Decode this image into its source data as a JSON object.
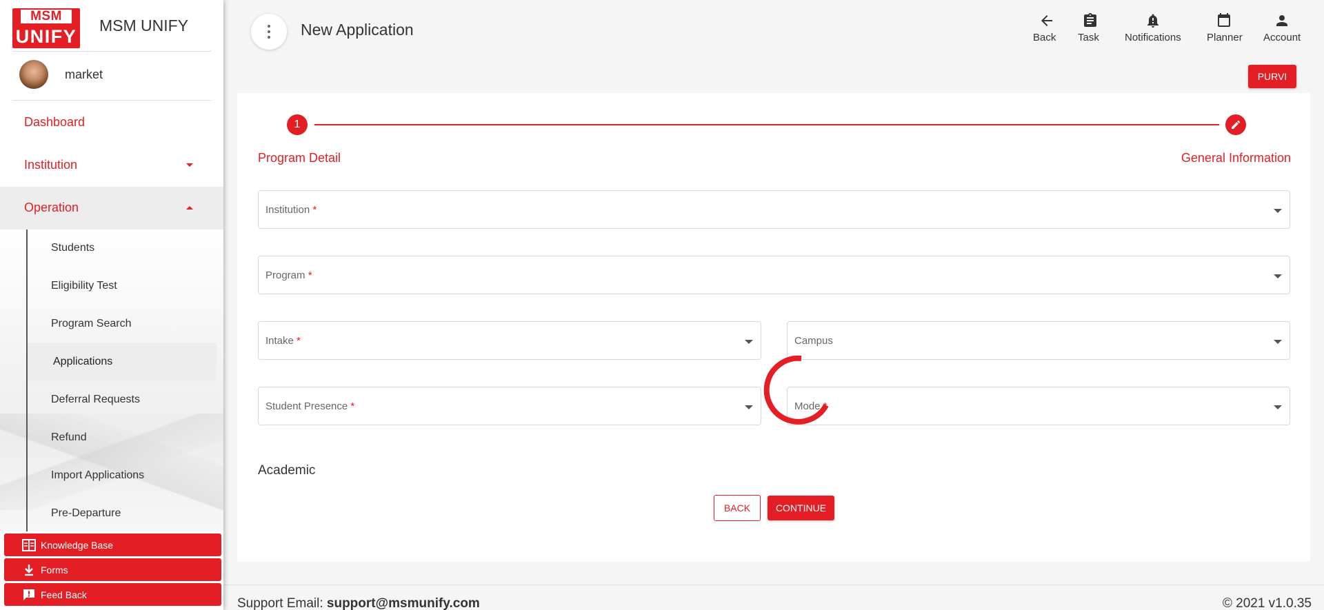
{
  "sidebar": {
    "brand": {
      "logo_top": "MSM",
      "logo_bottom": "UNIFY",
      "name": "MSM UNIFY"
    },
    "user": {
      "name": "market"
    },
    "nav": [
      {
        "label": "Dashboard"
      },
      {
        "label": "Institution",
        "caret": "down"
      },
      {
        "label": "Operation",
        "caret": "up",
        "active": true
      }
    ],
    "subnav": [
      {
        "label": "Students"
      },
      {
        "label": "Eligibility Test"
      },
      {
        "label": "Program Search"
      },
      {
        "label": "Applications",
        "active": true
      },
      {
        "label": "Deferral Requests"
      },
      {
        "label": "Refund"
      },
      {
        "label": "Import Applications"
      },
      {
        "label": "Pre-Departure"
      }
    ],
    "buttons": [
      {
        "label": "Knowledge Base",
        "icon": "book-icon"
      },
      {
        "label": "Forms",
        "icon": "download-icon"
      },
      {
        "label": "Feed Back",
        "icon": "feedback-icon"
      }
    ]
  },
  "header": {
    "title": "New Application",
    "actions": [
      {
        "label": "Back",
        "icon": "arrow-left-icon"
      },
      {
        "label": "Task",
        "icon": "clipboard-icon"
      },
      {
        "label": "Notifications",
        "icon": "bell-icon"
      },
      {
        "label": "Planner",
        "icon": "calendar-icon"
      },
      {
        "label": "Account",
        "icon": "person-icon"
      }
    ],
    "user_badge": "PURVI"
  },
  "stepper": {
    "step1_number": "1",
    "step1_label": "Program Detail",
    "step2_label": "General Information",
    "step2_icon": "pencil-icon"
  },
  "form": {
    "fields": {
      "institution": {
        "label": "Institution",
        "required": "*"
      },
      "program": {
        "label": "Program",
        "required": "*"
      },
      "intake": {
        "label": "Intake",
        "required": "*"
      },
      "campus": {
        "label": "Campus"
      },
      "student_presence": {
        "label": "Student Presence",
        "required": "*"
      },
      "mode": {
        "label": "Mode",
        "required": "*"
      }
    },
    "section_title": "Academic",
    "back_label": "BACK",
    "continue_label": "CONTINUE"
  },
  "footer": {
    "support_prefix": "Support Email: ",
    "support_email": "support@msmunify.com",
    "copyright": "© 2021 v1.0.35"
  },
  "colors": {
    "accent": "#e31e24",
    "background": "#f5f5f5",
    "card": "#ffffff"
  }
}
